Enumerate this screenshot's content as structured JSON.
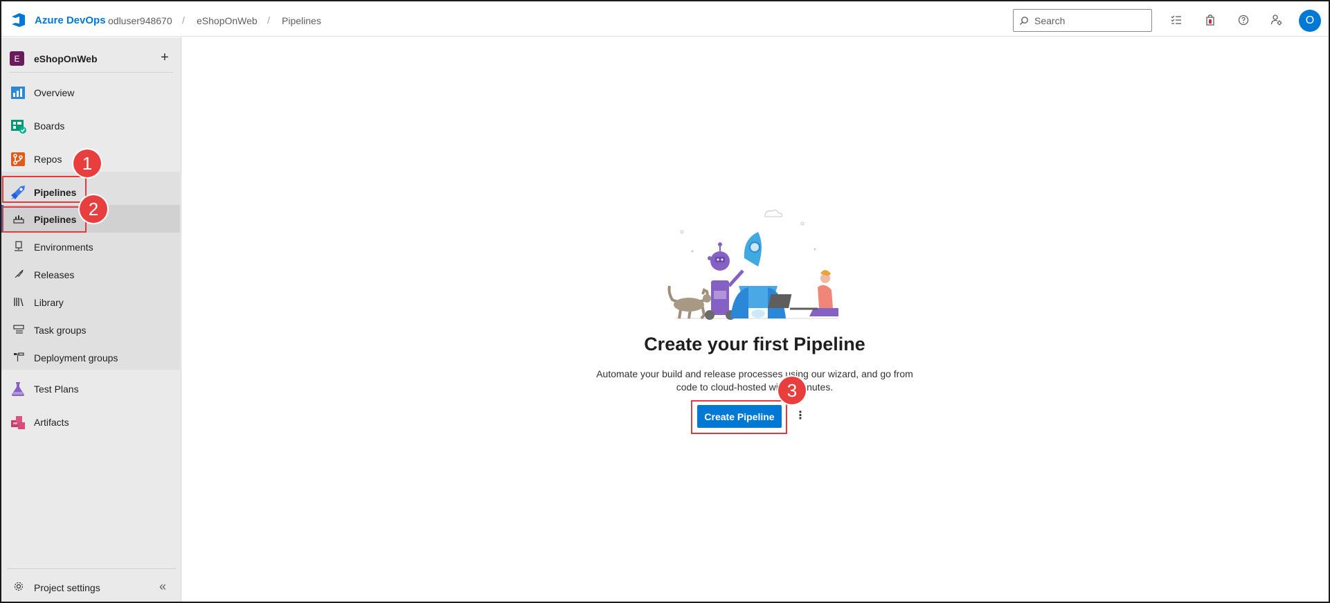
{
  "topbar": {
    "brand": "Azure DevOps",
    "breadcrumbs": [
      "odluser948670",
      "eShopOnWeb",
      "Pipelines"
    ],
    "separator": "/",
    "search_placeholder": "Search",
    "avatar_initial": "O",
    "icons": [
      "task-list-icon",
      "shopping-bag-icon",
      "help-icon",
      "user-settings-icon"
    ]
  },
  "sidebar": {
    "project_initial": "E",
    "project_name": "eShopOnWeb",
    "add_symbol": "+",
    "items": [
      {
        "label": "Overview",
        "icon": "overview-icon"
      },
      {
        "label": "Boards",
        "icon": "boards-icon"
      },
      {
        "label": "Repos",
        "icon": "repos-icon"
      },
      {
        "label": "Pipelines",
        "icon": "pipelines-icon"
      },
      {
        "label": "Test Plans",
        "icon": "test-plans-icon"
      },
      {
        "label": "Artifacts",
        "icon": "artifacts-icon"
      }
    ],
    "pipelines_sub": [
      {
        "label": "Pipelines",
        "icon": "pipelines-sub-icon"
      },
      {
        "label": "Environments",
        "icon": "environments-icon"
      },
      {
        "label": "Releases",
        "icon": "releases-icon"
      },
      {
        "label": "Library",
        "icon": "library-icon"
      },
      {
        "label": "Task groups",
        "icon": "task-groups-icon"
      },
      {
        "label": "Deployment groups",
        "icon": "deployment-groups-icon"
      }
    ],
    "settings_label": "Project settings",
    "collapse_symbol": "«"
  },
  "main": {
    "title": "Create your first Pipeline",
    "description": "Automate your build and release processes using our wizard, and go from code to cloud-hosted within minutes.",
    "create_button": "Create Pipeline",
    "more_symbol": "⋮"
  },
  "annotations": {
    "badges": [
      "1",
      "2",
      "3"
    ],
    "color": "#e83e3e"
  },
  "colors": {
    "accent": "#0078d4",
    "sidebar_bg": "#eaeaea"
  }
}
